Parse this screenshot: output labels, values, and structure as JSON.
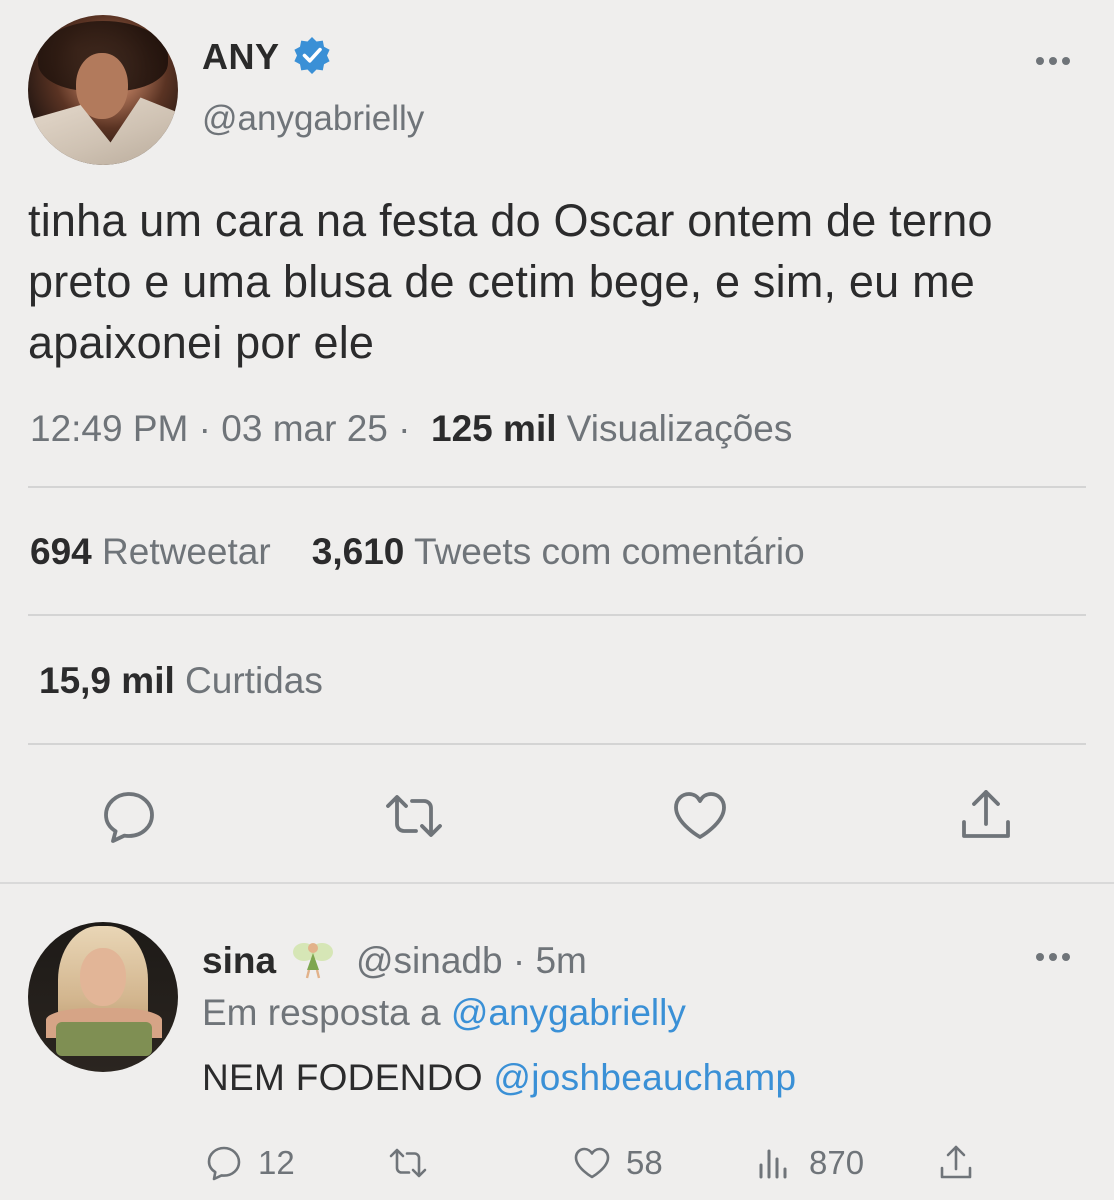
{
  "main_tweet": {
    "display_name": "ANY",
    "handle": "@anygabrielly",
    "text": "tinha um cara na festa do Oscar ontem de terno preto e uma blusa de cetim bege, e sim, eu me apaixonei por ele",
    "time": "12:49 PM",
    "date": "03 mar 25",
    "views_count": "125 mil",
    "views_label": "Visualizações",
    "retweets_count": "694",
    "retweets_label": "Retweetar",
    "quotes_count": "3,610",
    "quotes_label": "Tweets com comentário",
    "likes_count": "15,9 mil",
    "likes_label": "Curtidas"
  },
  "reply": {
    "display_name": "sina",
    "handle": "@sinadb",
    "time": "5m",
    "reply_prefix": "Em resposta a",
    "reply_to": "@anygabrielly",
    "text": "NEM FODENDO",
    "mention": "@joshbeauchamp",
    "reply_count": "12",
    "like_count": "58",
    "view_count": "870"
  },
  "colors": {
    "background": "#efeeed",
    "accent": "#3a90d6",
    "muted": "#6f7479",
    "text": "#2b2b2c",
    "verified": "#3a90d6"
  },
  "icons": [
    "verified-icon",
    "more-icon",
    "reply-icon",
    "retweet-icon",
    "like-icon",
    "share-icon",
    "views-icon",
    "fairy-emoji"
  ]
}
